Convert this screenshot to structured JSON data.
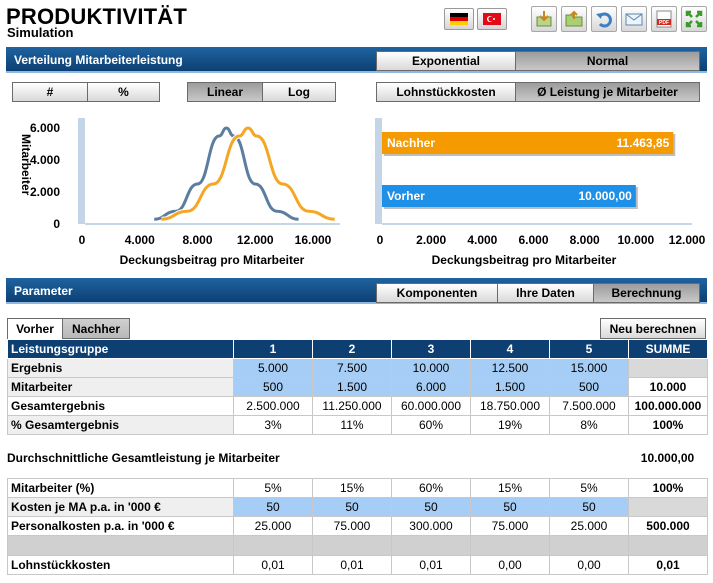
{
  "app": {
    "title": "PRODUKTIVITÄT",
    "subtitle": "Simulation"
  },
  "toolbar": {
    "language_flags": [
      "german-flag-icon",
      "turkish-flag-icon"
    ],
    "tools": [
      "import-icon",
      "open-folder-icon",
      "undo-icon",
      "email-icon",
      "pdf-icon",
      "fullscreen-icon"
    ],
    "pdf_label": "PDF"
  },
  "section1": {
    "title": "Verteilung Mitarbeiterleistung",
    "dist_buttons": [
      "Exponential",
      "Normal"
    ],
    "dist_selected": "Normal",
    "unit_buttons": [
      "#",
      "%"
    ],
    "scale_buttons": [
      "Linear",
      "Log"
    ],
    "scale_selected": "Linear",
    "metric_buttons": [
      "Lohnstückkosten",
      "Ø Leistung je Mitarbeiter"
    ],
    "metric_selected": "Ø Leistung je Mitarbeiter"
  },
  "chart_data": [
    {
      "type": "line",
      "xlabel": "Deckungsbeitrag pro Mitarbeiter",
      "ylabel": "Mitarbeiter",
      "xticks": [
        "0",
        "4.000",
        "8.000",
        "12.000",
        "16.000"
      ],
      "yticks": [
        "0",
        "2.000",
        "4.000",
        "6.000"
      ],
      "xlim": [
        0,
        17000
      ],
      "ylim": [
        0,
        6500
      ],
      "series": [
        {
          "color": "#5b7ea0",
          "x": [
            5000,
            6500,
            8000,
            9500,
            10000,
            10500,
            12000,
            13500,
            15000
          ],
          "y": [
            300,
            800,
            2500,
            5500,
            6000,
            5500,
            2500,
            800,
            300
          ]
        },
        {
          "color": "#f5a623",
          "x": [
            5500,
            7300,
            9100,
            10900,
            11500,
            12100,
            13900,
            15700,
            17500
          ],
          "y": [
            300,
            800,
            2500,
            5500,
            6000,
            5500,
            2500,
            800,
            300
          ]
        }
      ]
    },
    {
      "type": "bar",
      "xlabel": "Deckungsbeitrag pro Mitarbeiter",
      "xticks": [
        "0",
        "2.000",
        "4.000",
        "6.000",
        "8.000",
        "10.000",
        "12.000"
      ],
      "xlim": [
        0,
        12000
      ],
      "bars": [
        {
          "name": "Nachher",
          "value": 11463.85,
          "label": "11.463,85",
          "color": "#f59a00"
        },
        {
          "name": "Vorher",
          "value": 10000,
          "label": "10.000,00",
          "color": "#1e90e8"
        }
      ]
    }
  ],
  "section2": {
    "title": "Parameter",
    "tabs": [
      "Komponenten",
      "Ihre Daten",
      "Berechnung"
    ],
    "tab_selected": "Berechnung",
    "subtabs": [
      "Vorher",
      "Nachher"
    ],
    "recalc": "Neu berechnen"
  },
  "table1": {
    "headers": [
      "Leistungsgruppe",
      "1",
      "2",
      "3",
      "4",
      "5",
      "SUMME"
    ],
    "rows": [
      {
        "label": "Ergebnis",
        "cells": [
          "5.000",
          "7.500",
          "10.000",
          "12.500",
          "15.000"
        ],
        "sum": ""
      },
      {
        "label": "Mitarbeiter",
        "cells": [
          "500",
          "1.500",
          "6.000",
          "1.500",
          "500"
        ],
        "sum": "10.000"
      },
      {
        "label": "Gesamtergebnis",
        "cells": [
          "2.500.000",
          "11.250.000",
          "60.000.000",
          "18.750.000",
          "7.500.000"
        ],
        "sum": "100.000.000"
      },
      {
        "label": "% Gesamtergebnis",
        "cells": [
          "3%",
          "11%",
          "60%",
          "19%",
          "8%"
        ],
        "sum": "100%"
      }
    ]
  },
  "avg": {
    "label": "Durchschnittliche Gesamtleistung je Mitarbeiter",
    "value": "10.000,00"
  },
  "table2": {
    "rows": [
      {
        "label": "Mitarbeiter (%)",
        "cells": [
          "5%",
          "15%",
          "60%",
          "15%",
          "5%"
        ],
        "sum": "100%"
      },
      {
        "label": "Kosten je MA p.a. in '000 €",
        "cells": [
          "50",
          "50",
          "50",
          "50",
          "50"
        ],
        "sum": ""
      },
      {
        "label": "Personalkosten p.a. in '000 €",
        "cells": [
          "25.000",
          "75.000",
          "300.000",
          "75.000",
          "25.000"
        ],
        "sum": "500.000"
      },
      {
        "label": "Lohnstückkosten",
        "cells": [
          "0,01",
          "0,01",
          "0,01",
          "0,00",
          "0,00"
        ],
        "sum": "0,01"
      }
    ]
  }
}
